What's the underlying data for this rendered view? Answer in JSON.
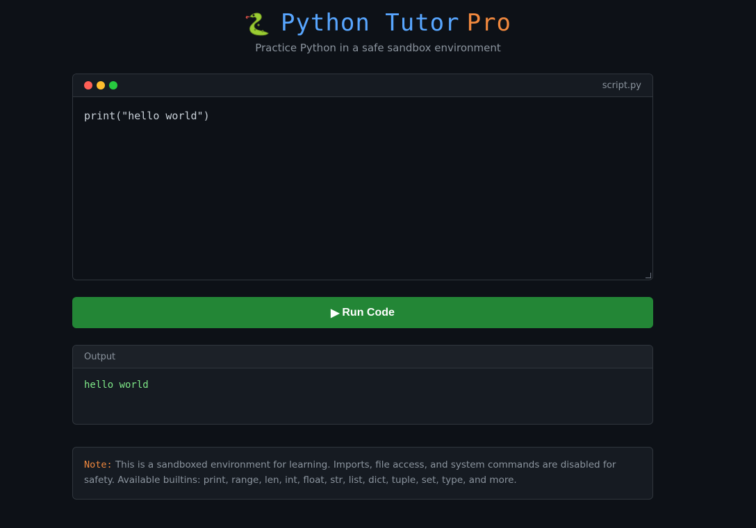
{
  "header": {
    "logo_icon": "snake-icon",
    "title_main": "Python Tutor",
    "title_accent": "Pro",
    "subtitle": "Practice Python in a safe sandbox environment"
  },
  "editor": {
    "filename": "script.py",
    "code": "print(\"hello world\")",
    "window_controls": [
      "close-dot",
      "minimize-dot",
      "maximize-dot"
    ]
  },
  "run_button": {
    "icon": "play-icon",
    "icon_glyph": "▶",
    "label": "Run Code"
  },
  "output": {
    "label": "Output",
    "text": "hello world"
  },
  "note": {
    "label": "Note:",
    "text": "This is a sandboxed environment for learning. Imports, file access, and system commands are disabled for safety. Available builtins: print, range, len, int, float, str, list, dict, tuple, set, type, and more."
  },
  "colors": {
    "background": "#0d1117",
    "title_blue": "#58a6ff",
    "accent_orange": "#f0883e",
    "run_green": "#238636",
    "output_green": "#7ee787"
  }
}
